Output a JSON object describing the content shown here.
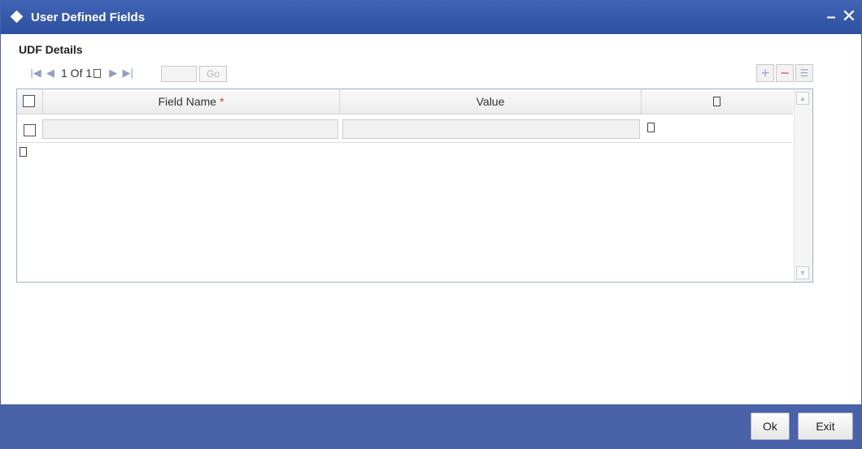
{
  "window": {
    "title": "User Defined Fields",
    "minimize_glyph": "–",
    "close_glyph": "✕"
  },
  "section": {
    "title": "UDF Details"
  },
  "pager": {
    "first_icon": "first-page-icon",
    "prev_icon": "prev-page-icon",
    "count_text": "1 Of 1",
    "next_icon": "next-page-icon",
    "last_icon": "last-page-icon",
    "page_input_value": "",
    "go_label": "Go"
  },
  "table_tools": {
    "add_glyph": "+",
    "delete_glyph": "−",
    "columns_glyph": "☰"
  },
  "grid": {
    "columns": [
      {
        "label": "Field Name",
        "required_mark": "*"
      },
      {
        "label": "Value"
      },
      {
        "label": ""
      }
    ],
    "rows": [
      {
        "field_name": "",
        "value": ""
      }
    ]
  },
  "footer": {
    "ok_label": "Ok",
    "exit_label": "Exit"
  },
  "colors": {
    "titlebar": "#3f63b6",
    "footer": "#4a62a8",
    "required": "#d23b3b"
  }
}
